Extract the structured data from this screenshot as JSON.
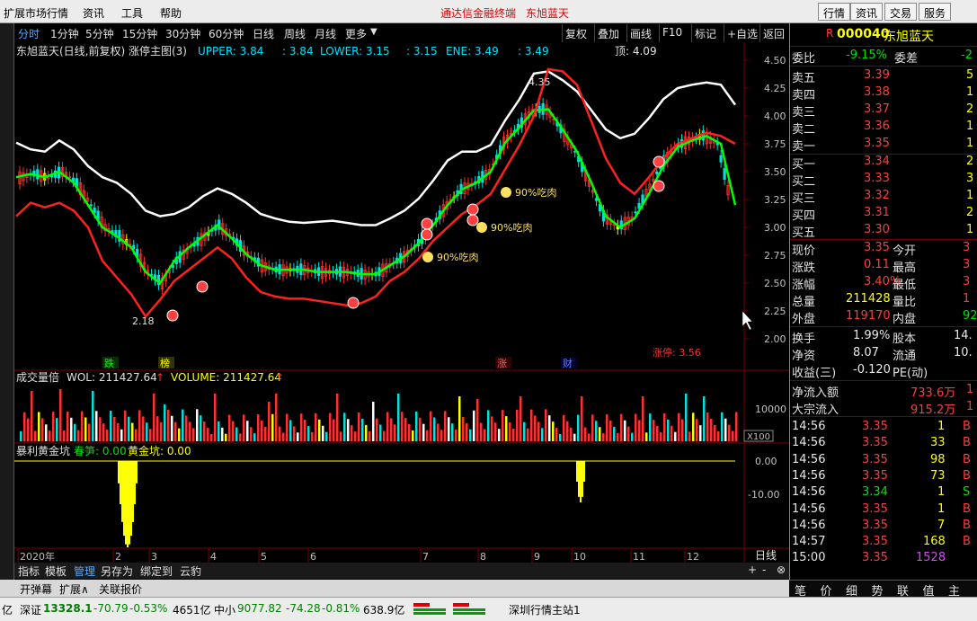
{
  "menubar": {
    "items": [
      "扩展市场行情",
      "资讯",
      "工具",
      "帮助"
    ],
    "brand": "通达信金融终端",
    "stock_name": "东旭蓝天",
    "right_buttons": [
      "行情",
      "资讯",
      "交易",
      "服务"
    ]
  },
  "toolbar": {
    "periods": [
      "分时",
      "1分钟",
      "5分钟",
      "15分钟",
      "30分钟",
      "60分钟",
      "日线",
      "周线",
      "月线",
      "更多"
    ],
    "active": "分时",
    "buttons": [
      "复权",
      "叠加",
      "画线",
      "F10",
      "标记",
      "+自选",
      "返回"
    ]
  },
  "main_chart": {
    "title": "东旭蓝天(日线,前复权) 涨停主图(3)",
    "upper_label": "UPPER: 3.84",
    "upper2": ": 3.84",
    "lower_label": "LOWER: 3.15",
    "lower2": ": 3.15",
    "ene_label": "ENE: 3.49",
    "ene2": ": 3.49",
    "top_label": "顶: 4.09",
    "high_mark": "4.35",
    "low_mark": "2.18",
    "rebound_labels": [
      "90%吃肉",
      "90%吃肉",
      "90%吃肉"
    ],
    "event_tags": [
      "跌",
      "榜",
      "涨",
      "财"
    ],
    "limit_label": "涨停: 3.56"
  },
  "volume_panel": {
    "title": "成交量倍",
    "wol": "WOL: 211427.64",
    "volume": "VOLUME: 211427.64",
    "y_label": "10000",
    "x100": "X100"
  },
  "indicator_panel": {
    "title": "暴利黄金坑",
    "spring": "春笋: 0.00",
    "gold": "黄金坑: 0.00",
    "y_labels": [
      "0.00",
      "-10.00"
    ]
  },
  "x_axis": {
    "labels": [
      "2020年",
      "2",
      "3",
      "4",
      "5",
      "6",
      "7",
      "8",
      "9",
      "10",
      "11",
      "12",
      "1"
    ],
    "period": "日线"
  },
  "chart_data": {
    "type": "line",
    "title": "东旭蓝天(日线,前复权) 涨停主图(3)",
    "ylim": [
      2.0,
      4.5
    ],
    "y_ticks": [
      "4.50",
      "4.25",
      "4.00",
      "3.75",
      "3.50",
      "3.25",
      "3.00",
      "2.75",
      "2.50",
      "2.25",
      "2.00"
    ],
    "series": [
      {
        "name": "UPPER",
        "color": "#ffffff",
        "values": [
          3.76,
          3.7,
          3.68,
          3.78,
          3.7,
          3.55,
          3.45,
          3.4,
          3.3,
          3.15,
          3.1,
          3.12,
          3.18,
          3.28,
          3.35,
          3.3,
          3.22,
          3.12,
          3.08,
          3.05,
          3.04,
          3.05,
          3.06,
          3.04,
          3.02,
          3.02,
          3.08,
          3.15,
          3.26,
          3.42,
          3.6,
          3.68,
          3.68,
          3.74,
          3.96,
          4.15,
          4.38,
          4.4,
          4.32,
          4.22,
          4.05,
          3.88,
          3.8,
          3.84,
          3.98,
          4.15,
          4.25,
          4.28,
          4.3,
          4.28,
          4.1
        ]
      },
      {
        "name": "ENE",
        "color": "#00ff00",
        "values": [
          3.45,
          3.48,
          3.45,
          3.5,
          3.4,
          3.2,
          3.0,
          2.92,
          2.82,
          2.6,
          2.5,
          2.7,
          2.82,
          2.92,
          3.02,
          2.9,
          2.76,
          2.66,
          2.62,
          2.62,
          2.62,
          2.6,
          2.6,
          2.6,
          2.58,
          2.58,
          2.66,
          2.74,
          2.86,
          3.02,
          3.2,
          3.34,
          3.4,
          3.5,
          3.76,
          3.9,
          4.05,
          4.06,
          3.88,
          3.68,
          3.4,
          3.1,
          3.0,
          3.08,
          3.3,
          3.55,
          3.72,
          3.78,
          3.82,
          3.75,
          3.2
        ]
      },
      {
        "name": "LOWER",
        "color": "#ff2020",
        "values": [
          3.1,
          3.22,
          3.18,
          3.22,
          3.15,
          3.0,
          2.7,
          2.55,
          2.4,
          2.2,
          2.35,
          2.52,
          2.62,
          2.72,
          2.82,
          2.72,
          2.55,
          2.42,
          2.38,
          2.36,
          2.36,
          2.34,
          2.32,
          2.3,
          2.32,
          2.38,
          2.52,
          2.6,
          2.72,
          2.88,
          3.0,
          3.12,
          3.2,
          3.3,
          3.52,
          3.74,
          4.0,
          4.42,
          4.4,
          4.28,
          3.95,
          3.62,
          3.4,
          3.3,
          3.45,
          3.62,
          3.75,
          3.8,
          3.85,
          3.82,
          3.75
        ]
      }
    ],
    "y_ticks_volume": [
      "10000"
    ],
    "y_ticks_indicator": [
      "0.00",
      "-10.00"
    ]
  },
  "right_panel": {
    "code": "000040",
    "name": "东旭蓝天",
    "weibi_label": "委比",
    "weibi": "-9.15%",
    "weicha_label": "委差",
    "weicha": "-2",
    "sells": [
      {
        "label": "卖五",
        "price": "3.39",
        "vol": "5"
      },
      {
        "label": "卖四",
        "price": "3.38",
        "vol": "1"
      },
      {
        "label": "卖三",
        "price": "3.37",
        "vol": "2"
      },
      {
        "label": "卖二",
        "price": "3.36",
        "vol": "1"
      },
      {
        "label": "卖一",
        "price": "3.35",
        "vol": "1"
      }
    ],
    "buys": [
      {
        "label": "买一",
        "price": "3.34",
        "vol": "2"
      },
      {
        "label": "买二",
        "price": "3.33",
        "vol": "3"
      },
      {
        "label": "买三",
        "price": "3.32",
        "vol": "1"
      },
      {
        "label": "买四",
        "price": "3.31",
        "vol": "2"
      },
      {
        "label": "买五",
        "price": "3.30",
        "vol": "1"
      }
    ],
    "stats": [
      {
        "l1": "现价",
        "v1": "3.35",
        "l2": "今开",
        "v2": "3"
      },
      {
        "l1": "涨跌",
        "v1": "0.11",
        "l2": "最高",
        "v2": "3"
      },
      {
        "l1": "涨幅",
        "v1": "3.40%",
        "l2": "最低",
        "v2": "3"
      },
      {
        "l1": "总量",
        "v1": "211428",
        "l2": "量比",
        "v2": "1"
      },
      {
        "l1": "外盘",
        "v1": "119170",
        "l2": "内盘",
        "v2": "92"
      }
    ],
    "stats2": [
      {
        "l1": "换手",
        "v1": "1.99%",
        "l2": "股本",
        "v2": "14."
      },
      {
        "l1": "净资",
        "v1": "8.07",
        "l2": "流通",
        "v2": "10."
      },
      {
        "l1": "收益(三)",
        "v1": "-0.120",
        "l2": "PE(动)",
        "v2": ""
      }
    ],
    "flow": [
      {
        "label": "净流入额",
        "value": "733.6万",
        "extra": "1"
      },
      {
        "label": "大宗流入",
        "value": "915.2万",
        "extra": "1"
      }
    ],
    "ticks": [
      {
        "time": "14:56",
        "price": "3.35",
        "vol": "1",
        "side": "B"
      },
      {
        "time": "14:56",
        "price": "3.35",
        "vol": "33",
        "side": "B"
      },
      {
        "time": "14:56",
        "price": "3.35",
        "vol": "98",
        "side": "B"
      },
      {
        "time": "14:56",
        "price": "3.35",
        "vol": "73",
        "side": "B"
      },
      {
        "time": "14:56",
        "price": "3.34",
        "vol": "1",
        "side": "S"
      },
      {
        "time": "14:56",
        "price": "3.35",
        "vol": "1",
        "side": "B"
      },
      {
        "time": "14:56",
        "price": "3.35",
        "vol": "7",
        "side": "B"
      },
      {
        "time": "14:57",
        "price": "3.35",
        "vol": "168",
        "side": "B"
      },
      {
        "time": "15:00",
        "price": "3.35",
        "vol": "1528",
        "side": ""
      }
    ],
    "tabs": [
      "笔",
      "价",
      "细",
      "势",
      "联",
      "值",
      "主"
    ]
  },
  "bottom_tabs": [
    "指标",
    "模板",
    "管理",
    "另存为",
    "绑定到",
    "云豹"
  ],
  "bottom_active": "管理",
  "row2": [
    "开弹幕",
    "扩展∧",
    "关联报价"
  ],
  "statusbar": {
    "left": "亿",
    "sz_label": "深证",
    "sz_value": "13328.1",
    "sz_change": "-70.79",
    "sz_pct": "-0.53%",
    "sz_amount": "4651亿",
    "zx_label": "中小",
    "zx_value": "9077.82",
    "zx_change": "-74.28",
    "zx_pct": "-0.81%",
    "zx_amount": "638.9亿",
    "station": "深圳行情主站1"
  }
}
